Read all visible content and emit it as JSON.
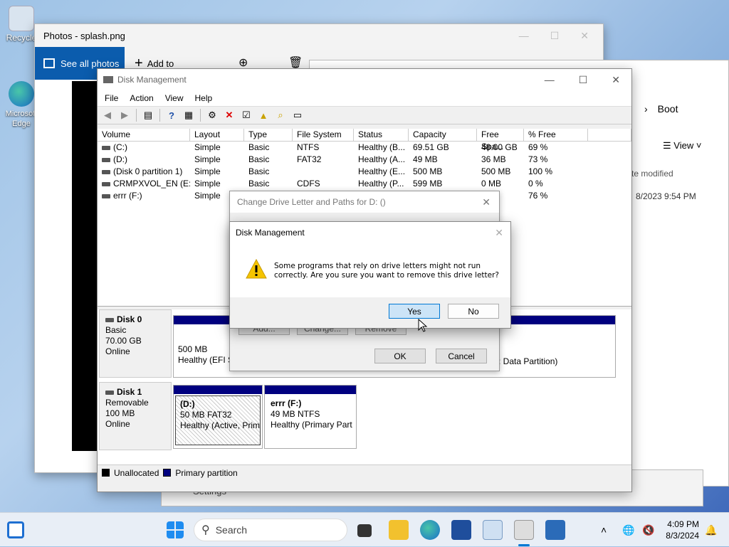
{
  "desktop": {
    "icons": [
      {
        "label": "Recycle"
      },
      {
        "label": "Microsoft Edge"
      }
    ]
  },
  "photos": {
    "title": "Photos - splash.png",
    "see_all": "See all photos",
    "add_to": "Add to"
  },
  "explorer": {
    "breadcrumb": "Boot",
    "view": "View",
    "col_date": "te modified",
    "row_date": "8/2023 9:54 PM",
    "settings": "Settings"
  },
  "disk_mgmt": {
    "title": "Disk Management",
    "menu": [
      "File",
      "Action",
      "View",
      "Help"
    ],
    "columns": [
      "Volume",
      "Layout",
      "Type",
      "File System",
      "Status",
      "Capacity",
      "Free Spa...",
      "% Free"
    ],
    "volumes": [
      {
        "volume": "(C:)",
        "layout": "Simple",
        "type": "Basic",
        "fs": "NTFS",
        "status": "Healthy (B...",
        "capacity": "69.51 GB",
        "free": "48.00 GB",
        "pct": "69 %"
      },
      {
        "volume": "(D:)",
        "layout": "Simple",
        "type": "Basic",
        "fs": "FAT32",
        "status": "Healthy (A...",
        "capacity": "49 MB",
        "free": "36 MB",
        "pct": "73 %"
      },
      {
        "volume": "(Disk 0 partition 1)",
        "layout": "Simple",
        "type": "Basic",
        "fs": "",
        "status": "Healthy (E...",
        "capacity": "500 MB",
        "free": "500 MB",
        "pct": "100 %"
      },
      {
        "volume": "CRMPXVOL_EN (E:)",
        "layout": "Simple",
        "type": "Basic",
        "fs": "CDFS",
        "status": "Healthy (P...",
        "capacity": "599 MB",
        "free": "0 MB",
        "pct": "0 %"
      },
      {
        "volume": "errr (F:)",
        "layout": "Simple",
        "type": "",
        "fs": "",
        "status": "",
        "capacity": "",
        "free": "B",
        "pct": "76 %"
      }
    ],
    "disk0": {
      "name": "Disk 0",
      "type": "Basic",
      "size": "70.00 GB",
      "state": "Online",
      "p1_size": "500 MB",
      "p1_status": "Healthy (EFI S",
      "p2_status": ": Data Partition)"
    },
    "disk1": {
      "name": "Disk 1",
      "type": "Removable",
      "size": "100 MB",
      "state": "Online",
      "p1_name": "(D:)",
      "p1_size": "50 MB FAT32",
      "p1_status": "Healthy (Active, Prim",
      "p2_name": "errr  (F:)",
      "p2_size": "49 MB NTFS",
      "p2_status": "Healthy (Primary Part"
    },
    "legend": {
      "unallocated": "Unallocated",
      "primary": "Primary partition"
    }
  },
  "change_dialog": {
    "title": "Change Drive Letter and Paths for D: ()",
    "add": "Add...",
    "change": "Change...",
    "remove": "Remove",
    "ok": "OK",
    "cancel": "Cancel"
  },
  "confirm": {
    "title": "Disk Management",
    "line1": "Some programs that rely on drive letters might not run",
    "line2": "correctly. Are you sure you want to remove this drive letter?",
    "yes": "Yes",
    "no": "No"
  },
  "taskbar": {
    "search_placeholder": "Search",
    "time": "4:09 PM",
    "date": "8/3/2024"
  },
  "colors": {
    "accent": "#0078d4",
    "primary_partition": "#00007f",
    "photos_accent": "#0b5cad"
  }
}
